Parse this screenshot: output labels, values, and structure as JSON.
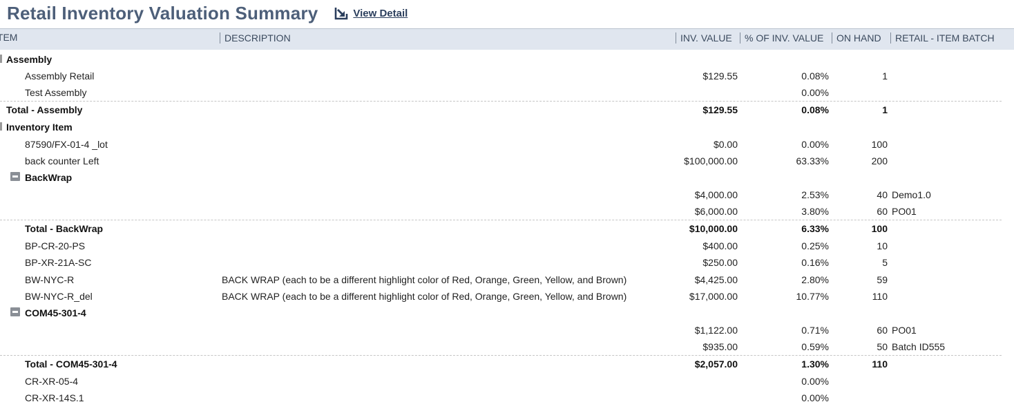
{
  "header": {
    "title": "Retail Inventory Valuation Summary",
    "view_detail_label": "View Detail",
    "view_detail_icon": "external-link-arrow-icon"
  },
  "columns": {
    "item": "ITEM",
    "description": "DESCRIPTION",
    "inv_value": "INV. VALUE",
    "pct_inv_value": "% OF INV. VALUE",
    "on_hand": "ON HAND",
    "retail_batch": "RETAIL - ITEM BATCH"
  },
  "rows": {
    "assembly_group": {
      "item": "Assembly"
    },
    "assembly_retail": {
      "item": "Assembly Retail",
      "value": "$129.55",
      "pct": "0.08%",
      "on_hand": "1"
    },
    "test_assembly": {
      "item": "Test Assembly",
      "pct": "0.00%"
    },
    "total_assembly": {
      "item": "Total - Assembly",
      "value": "$129.55",
      "pct": "0.08%",
      "on_hand": "1"
    },
    "inventory_group": {
      "item": "Inventory Item"
    },
    "lot_87590": {
      "item": "87590/FX-01-4 _lot",
      "value": "$0.00",
      "pct": "0.00%",
      "on_hand": "100"
    },
    "back_counter": {
      "item": "back counter Left",
      "value": "$100,000.00",
      "pct": "63.33%",
      "on_hand": "200"
    },
    "backwrap_group": {
      "item": "BackWrap"
    },
    "backwrap_b1": {
      "value": "$4,000.00",
      "pct": "2.53%",
      "on_hand": "40",
      "batch": "Demo1.0"
    },
    "backwrap_b2": {
      "value": "$6,000.00",
      "pct": "3.80%",
      "on_hand": "60",
      "batch": "PO01"
    },
    "total_backwrap": {
      "item": "Total - BackWrap",
      "value": "$10,000.00",
      "pct": "6.33%",
      "on_hand": "100"
    },
    "bp_cr": {
      "item": "BP-CR-20-PS",
      "value": "$400.00",
      "pct": "0.25%",
      "on_hand": "10"
    },
    "bp_xr": {
      "item": "BP-XR-21A-SC",
      "value": "$250.00",
      "pct": "0.16%",
      "on_hand": "5"
    },
    "bw_nyc_r": {
      "item": "BW-NYC-R",
      "description": "BACK WRAP (each to be a different highlight color of Red, Orange, Green, Yellow, and Brown)",
      "value": "$4,425.00",
      "pct": "2.80%",
      "on_hand": "59"
    },
    "bw_nyc_r_del": {
      "item": "BW-NYC-R_del",
      "description": "BACK WRAP (each to be a different highlight color of Red, Orange, Green, Yellow, and Brown)",
      "value": "$17,000.00",
      "pct": "10.77%",
      "on_hand": "110"
    },
    "com45_group": {
      "item": "COM45-301-4"
    },
    "com45_b1": {
      "value": "$1,122.00",
      "pct": "0.71%",
      "on_hand": "60",
      "batch": "PO01"
    },
    "com45_b2": {
      "value": "$935.00",
      "pct": "0.59%",
      "on_hand": "50",
      "batch": "Batch ID555"
    },
    "total_com45": {
      "item": "Total - COM45-301-4",
      "value": "$2,057.00",
      "pct": "1.30%",
      "on_hand": "110"
    },
    "cr_xr_05": {
      "item": "CR-XR-05-4",
      "pct": "0.00%"
    },
    "cr_xr_14s": {
      "item": "CR-XR-14S.1",
      "pct": "0.00%"
    }
  }
}
